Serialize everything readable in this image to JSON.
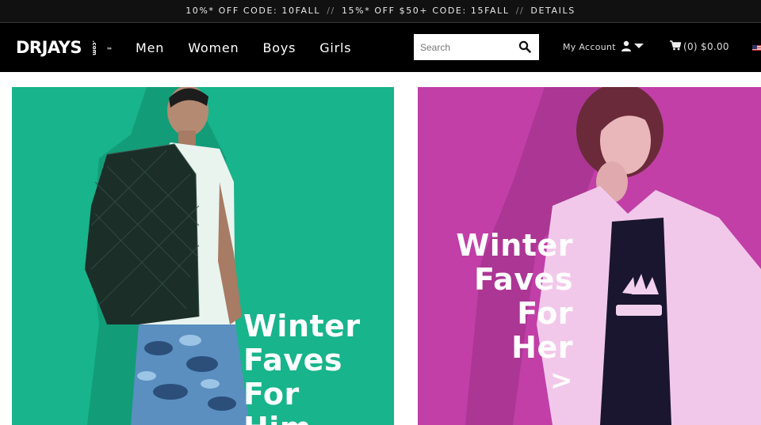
{
  "promo": {
    "code1": "10%* OFF CODE: 10FALL",
    "sep1": "//",
    "code2": "15%* OFF $50+ CODE: 15FALL",
    "sep2": "//",
    "details": "DETAILS"
  },
  "header": {
    "logo_text": "DRJAYS",
    "logo_suffix": ".com",
    "logo_tm": "™",
    "nav": [
      "Men",
      "Women",
      "Boys",
      "Girls"
    ],
    "search_placeholder": "Search",
    "account_label": "My Account",
    "cart_label": "(0) $0.00"
  },
  "banners": {
    "him": {
      "line1": "Winter",
      "line2": "Faves",
      "line3": "For",
      "line4": "Him",
      "bg": "#19b38a"
    },
    "her": {
      "line1": "Winter",
      "line2": "Faves",
      "line3": "For",
      "line4": "Her",
      "arrow": ">",
      "bg": "#c040a8"
    }
  },
  "icons": {
    "search": "search-icon",
    "user": "user-icon",
    "caret": "caret-down-icon",
    "cart": "cart-icon",
    "flag": "us-flag-icon"
  }
}
